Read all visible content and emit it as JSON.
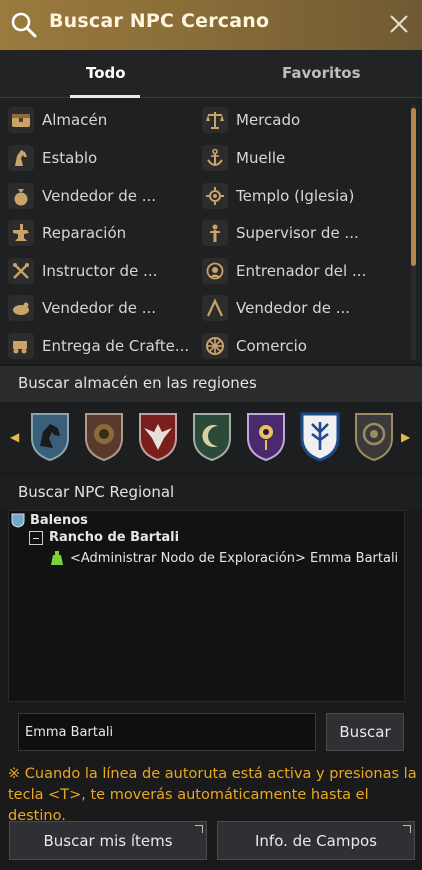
{
  "header": {
    "title": "Buscar NPC Cercano"
  },
  "tabs": [
    {
      "label": "Todo",
      "active": true
    },
    {
      "label": "Favoritos",
      "active": false
    }
  ],
  "npc_list": [
    {
      "label": "Almacén",
      "icon": "storage-icon"
    },
    {
      "label": "Mercado",
      "icon": "scales-icon"
    },
    {
      "label": "Establo",
      "icon": "horse-icon"
    },
    {
      "label": "Muelle",
      "icon": "anchor-icon"
    },
    {
      "label": "Vendedor de ...",
      "icon": "money-bag-icon"
    },
    {
      "label": "Templo (Iglesia)",
      "icon": "temple-icon"
    },
    {
      "label": "Reparación",
      "icon": "anvil-icon"
    },
    {
      "label": "Supervisor de ...",
      "icon": "supervisor-icon"
    },
    {
      "label": "Instructor de ...",
      "icon": "crossed-weapons-icon"
    },
    {
      "label": "Entrenador del ...",
      "icon": "trainer-icon"
    },
    {
      "label": "Vendedor de ...",
      "icon": "chicken-icon"
    },
    {
      "label": "Vendedor de ...",
      "icon": "fishing-icon"
    },
    {
      "label": "Entrega de Crafte...",
      "icon": "wagon-icon"
    },
    {
      "label": "Comercio",
      "icon": "trade-wheel-icon"
    }
  ],
  "almacen_section": {
    "title": "Buscar almacén en las regiones"
  },
  "region_shields": [
    {
      "icon": "horse-shield-icon",
      "color": "#3a5f7a"
    },
    {
      "icon": "lion-shield-icon",
      "color": "#5a3a2e"
    },
    {
      "icon": "eagle-shield-icon",
      "color": "#7a1e1e"
    },
    {
      "icon": "crescent-shield-icon",
      "color": "#2c4a3a"
    },
    {
      "icon": "eye-shield-icon",
      "color": "#4a2a6a"
    },
    {
      "icon": "tree-shield-icon",
      "color": "#1e4a8a"
    },
    {
      "icon": "dragon-shield-icon",
      "color": "#3a3a3a"
    }
  ],
  "regional_section": {
    "title": "Buscar NPC Regional"
  },
  "tree": {
    "region": "Balenos",
    "node": "Rancho de Bartali",
    "npc": "<Administrar Nodo de Exploración> Emma Bartali"
  },
  "search": {
    "value": "Emma Bartali",
    "button": "Buscar"
  },
  "notice": "※ Cuando la línea de autoruta está activa y presionas la tecla <T>, te moverás automáticamente hasta el destino.",
  "footer": {
    "items_button": "Buscar mis ítems",
    "fields_button": "Info. de Campos"
  },
  "colors": {
    "accent": "#e9a820",
    "header": "#9a7a3e"
  }
}
